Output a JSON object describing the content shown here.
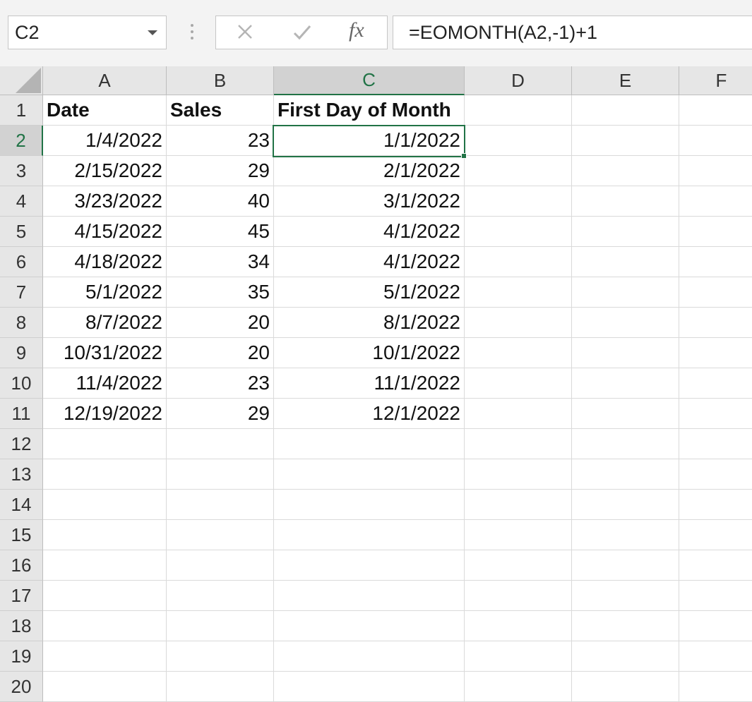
{
  "formula_bar": {
    "name_box": "C2",
    "formula": "=EOMONTH(A2,-1)+1",
    "fx_label": "fx"
  },
  "columns": [
    "A",
    "B",
    "C",
    "D",
    "E",
    "F"
  ],
  "active_cell": {
    "column": "C",
    "row": "2"
  },
  "rows": [
    {
      "row": "1",
      "A": "Date",
      "B": "Sales",
      "C": "First Day of Month"
    },
    {
      "row": "2",
      "A": "1/4/2022",
      "B": "23",
      "C": "1/1/2022"
    },
    {
      "row": "3",
      "A": "2/15/2022",
      "B": "29",
      "C": "2/1/2022"
    },
    {
      "row": "4",
      "A": "3/23/2022",
      "B": "40",
      "C": "3/1/2022"
    },
    {
      "row": "5",
      "A": "4/15/2022",
      "B": "45",
      "C": "4/1/2022"
    },
    {
      "row": "6",
      "A": "4/18/2022",
      "B": "34",
      "C": "4/1/2022"
    },
    {
      "row": "7",
      "A": "5/1/2022",
      "B": "35",
      "C": "5/1/2022"
    },
    {
      "row": "8",
      "A": "8/7/2022",
      "B": "20",
      "C": "8/1/2022"
    },
    {
      "row": "9",
      "A": "10/31/2022",
      "B": "20",
      "C": "10/1/2022"
    },
    {
      "row": "10",
      "A": "11/4/2022",
      "B": "23",
      "C": "11/1/2022"
    },
    {
      "row": "11",
      "A": "12/19/2022",
      "B": "29",
      "C": "12/1/2022"
    },
    {
      "row": "12"
    },
    {
      "row": "13"
    },
    {
      "row": "14"
    },
    {
      "row": "15"
    },
    {
      "row": "16"
    },
    {
      "row": "17"
    },
    {
      "row": "18"
    },
    {
      "row": "19"
    },
    {
      "row": "20"
    }
  ],
  "colors": {
    "accent": "#217346",
    "header_bg": "#e6e6e6",
    "gridline": "#dadada"
  }
}
